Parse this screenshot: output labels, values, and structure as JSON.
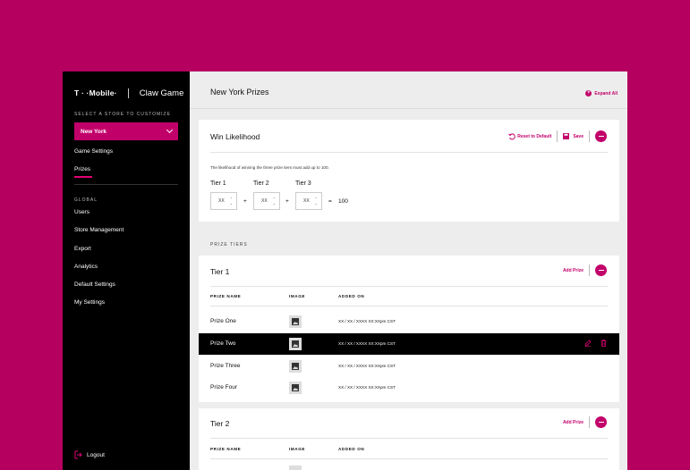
{
  "brand": {
    "logo": "T · ·Mobile·",
    "app_name": "Claw Game"
  },
  "sidebar": {
    "store_caption": "SELECT A STORE TO CUSTOMIZE",
    "store_selected": "New York",
    "store_items": [
      {
        "label": "Game Settings"
      },
      {
        "label": "Prizes",
        "active": true
      }
    ],
    "global_caption": "GLOBAL",
    "global_items": [
      {
        "label": "Users"
      },
      {
        "label": "Store Management"
      },
      {
        "label": "Export"
      },
      {
        "label": "Analytics"
      },
      {
        "label": "Default Settings"
      },
      {
        "label": "My Settings"
      }
    ],
    "logout_label": "Logout"
  },
  "header": {
    "title": "New York Prizes",
    "expand_all": "Expand All"
  },
  "win_likelihood": {
    "title": "Win Likelihood",
    "reset_label": "Reset to Default",
    "save_label": "Save",
    "note": "The likelihood of winning the three prize tiers must add up to 100.",
    "tiers": [
      {
        "label": "Tier 1",
        "value": "XX"
      },
      {
        "label": "Tier 2",
        "value": "XX"
      },
      {
        "label": "Tier 3",
        "value": "XX"
      }
    ],
    "plus": "+",
    "equals": "=",
    "total": "100"
  },
  "prize_tiers": {
    "caption": "PRIZE TIERS",
    "columns": [
      "PRIZE NAME",
      "IMAGE",
      "ADDED ON"
    ],
    "add_prize_label": "Add Prize",
    "tiers": [
      {
        "title": "Tier 1",
        "rows": [
          {
            "name": "Prize One",
            "added_on": "XX / XX / XXXX XX:XXpm CST"
          },
          {
            "name": "Prize Two",
            "added_on": "XX / XX / XXXX XX:XXpm CST",
            "selected": true
          },
          {
            "name": "Prize Three",
            "added_on": "XX / XX / XXXX XX:XXpm CST"
          },
          {
            "name": "Prize Four",
            "added_on": "XX / XX / XXXX XX:XXpm CST"
          }
        ]
      },
      {
        "title": "Tier 2",
        "rows": []
      }
    ]
  },
  "colors": {
    "brand_magenta": "#e20074",
    "background": "#b5005f",
    "sidebar": "#000000"
  }
}
